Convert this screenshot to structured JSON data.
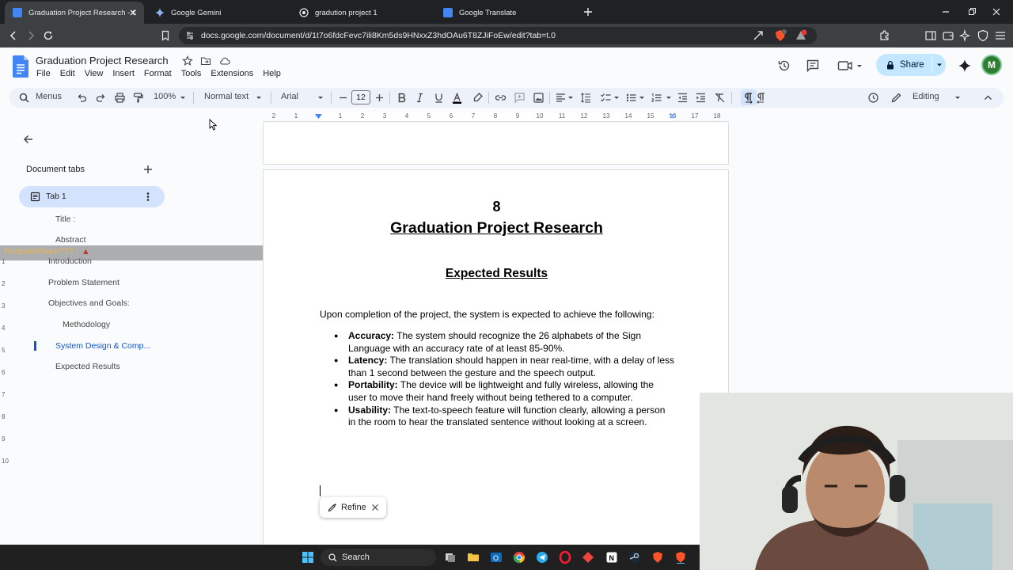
{
  "browser": {
    "tabs": [
      {
        "title": "Graduation Project Research - Goog",
        "active": true
      },
      {
        "title": "Google Gemini",
        "active": false
      },
      {
        "title": "gradution project 1",
        "active": false
      },
      {
        "title": "Google Translate",
        "active": false
      }
    ],
    "url": "docs.google.com/document/d/1t7o6fdcFevc7ili8Km5ds9HNxxZ3hdOAu6T8ZJiFoEw/edit?tab=t.0"
  },
  "docs": {
    "title": "Graduation Project Research",
    "menu": [
      "File",
      "Edit",
      "View",
      "Insert",
      "Format",
      "Tools",
      "Extensions",
      "Help"
    ],
    "share_label": "Share",
    "avatar_initial": "M"
  },
  "toolbar": {
    "menus_label": "Menus",
    "zoom": "100%",
    "style": "Normal text",
    "font": "Arial",
    "font_size": "12",
    "mode": "Editing"
  },
  "ruler": {
    "numbers": [
      "2",
      "1",
      "1",
      "2",
      "3",
      "4",
      "5",
      "6",
      "7",
      "8",
      "9",
      "10",
      "11",
      "12",
      "13",
      "14",
      "15",
      "16",
      "17",
      "18"
    ],
    "vertical_numbers": [
      "1",
      "2",
      "3",
      "4",
      "5",
      "6",
      "7",
      "8",
      "9",
      "10"
    ]
  },
  "sidebar": {
    "heading": "Document tabs",
    "tab_name": "Tab 1",
    "outline": [
      {
        "label": "Title :"
      },
      {
        "label": "Abstract"
      },
      {
        "label": "Introduction"
      },
      {
        "label": "Problem Statement"
      },
      {
        "label": "Objectives and Goals:"
      },
      {
        "label": "Methodology"
      },
      {
        "label": "System Design & Comp..."
      },
      {
        "label": "Expected Results"
      }
    ],
    "overlay_text": "FortuneFlash777 :"
  },
  "document": {
    "page_number": "8",
    "title": "Graduation Project Research",
    "section_heading": "Expected Results",
    "intro": "Upon completion of the project, the system is expected to achieve the following:",
    "bullets": [
      {
        "term": "Accuracy:",
        "text": " The system should recognize the 26 alphabets of the Sign Language with an accuracy rate of at least 85-90%."
      },
      {
        "term": "Latency:",
        "text": " The translation should happen in near real-time, with a delay of less than 1 second between the gesture and the speech output."
      },
      {
        "term": "Portability:",
        "text": " The device will be lightweight and fully wireless, allowing the user to move their hand freely without being tethered to a computer."
      },
      {
        "term": "Usability:",
        "text": " The text-to-speech feature will function clearly, allowing a person in the room to hear the translated sentence without looking at a screen."
      }
    ],
    "refine_label": "Refine"
  },
  "taskbar": {
    "search_label": "Search"
  },
  "colors": {
    "accent_blue": "#0b57d0",
    "share_bg": "#c2e7ff",
    "toolbar_bg": "#edf2fa",
    "docs_blue": "#4285f4"
  }
}
